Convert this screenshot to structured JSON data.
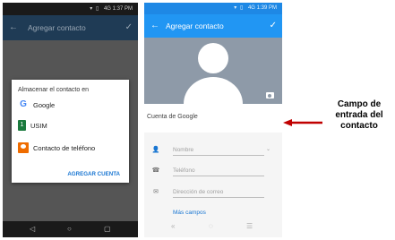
{
  "left_phone": {
    "status": {
      "signal": "▾ ▯",
      "network": "4G",
      "time": "1:37 PM"
    },
    "appbar": {
      "back_icon": "←",
      "title": "Agregar contacto",
      "check_icon": "✓"
    },
    "dialog": {
      "title": "Almacenar el contacto en",
      "options": [
        {
          "icon": "google-icon",
          "glyph": "G",
          "label": "Google"
        },
        {
          "icon": "sim-icon",
          "glyph": "1",
          "label": "USIM"
        },
        {
          "icon": "phone-contact-icon",
          "glyph": "",
          "label": "Contacto de teléfono"
        }
      ],
      "add_account": "AGREGAR CUENTA"
    },
    "nav": {
      "back": "◁",
      "home": "○",
      "recents": "▢"
    }
  },
  "right_phone": {
    "status": {
      "signal": "▾ ▯",
      "network": "4G",
      "time": "1:39 PM"
    },
    "appbar": {
      "back_icon": "←",
      "title": "Agregar contacto",
      "check_icon": "✓"
    },
    "account_label": "Cuenta de Google",
    "fields": [
      {
        "icon": "person-icon",
        "glyph": "👤",
        "placeholder": "Nombre",
        "has_dropdown": true,
        "dropdown_glyph": "⌄"
      },
      {
        "icon": "phone-icon",
        "glyph": "☎",
        "placeholder": "Teléfono",
        "has_dropdown": false
      },
      {
        "icon": "email-icon",
        "glyph": "✉",
        "placeholder": "Dirección de correo",
        "has_dropdown": false
      }
    ],
    "more_fields": "Más campos",
    "nav": {
      "back": "«",
      "home": "◌",
      "recents": "☰"
    }
  },
  "annotation": {
    "lines": [
      "Campo de",
      "entrada del",
      "contacto"
    ],
    "arrow_color": "#c00000"
  },
  "colors": {
    "blue_primary": "#2196f3",
    "blue_dark": "#1e88e5",
    "link_blue": "#1976d2",
    "dim_overlay": "#555555",
    "photo_bg": "#8e9aa8"
  }
}
